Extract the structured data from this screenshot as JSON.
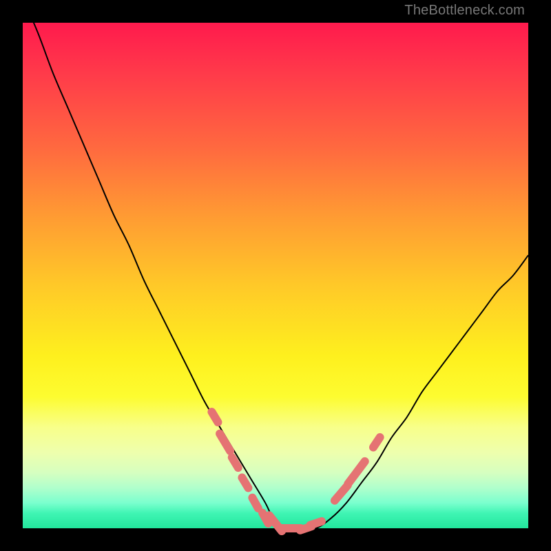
{
  "watermark": "TheBottleneck.com",
  "colors": {
    "frame_bg": "#000000",
    "curve_stroke": "#000000",
    "marker_fill": "#e57373",
    "marker_stroke": "#b35a5a"
  },
  "chart_data": {
    "type": "line",
    "title": "",
    "xlabel": "",
    "ylabel": "",
    "xlim": [
      0,
      100
    ],
    "ylim": [
      0,
      100
    ],
    "x": [
      0,
      3,
      6,
      9,
      12,
      15,
      18,
      21,
      24,
      27,
      30,
      33,
      36,
      39,
      42,
      45,
      48,
      50,
      52,
      55,
      58,
      61,
      64,
      67,
      70,
      73,
      76,
      79,
      82,
      85,
      88,
      91,
      94,
      97,
      100
    ],
    "values": [
      105,
      98,
      90,
      83,
      76,
      69,
      62,
      56,
      49,
      43,
      37,
      31,
      25,
      20,
      15,
      10,
      5,
      1,
      0,
      0,
      0,
      2,
      5,
      9,
      13,
      18,
      22,
      27,
      31,
      35,
      39,
      43,
      47,
      50,
      54
    ],
    "markers": [
      {
        "x": 38,
        "y": 22,
        "len": 2
      },
      {
        "x": 40,
        "y": 17,
        "len": 3
      },
      {
        "x": 42,
        "y": 13,
        "len": 2
      },
      {
        "x": 44,
        "y": 9,
        "len": 2
      },
      {
        "x": 46,
        "y": 5,
        "len": 2
      },
      {
        "x": 48,
        "y": 2,
        "len": 2
      },
      {
        "x": 50,
        "y": 1,
        "len": 3
      },
      {
        "x": 53,
        "y": 0,
        "len": 3
      },
      {
        "x": 56,
        "y": 0,
        "len": 2
      },
      {
        "x": 58,
        "y": 1,
        "len": 2
      },
      {
        "x": 63,
        "y": 7,
        "len": 3
      },
      {
        "x": 66,
        "y": 11,
        "len": 4
      },
      {
        "x": 70,
        "y": 17,
        "len": 2
      }
    ]
  }
}
